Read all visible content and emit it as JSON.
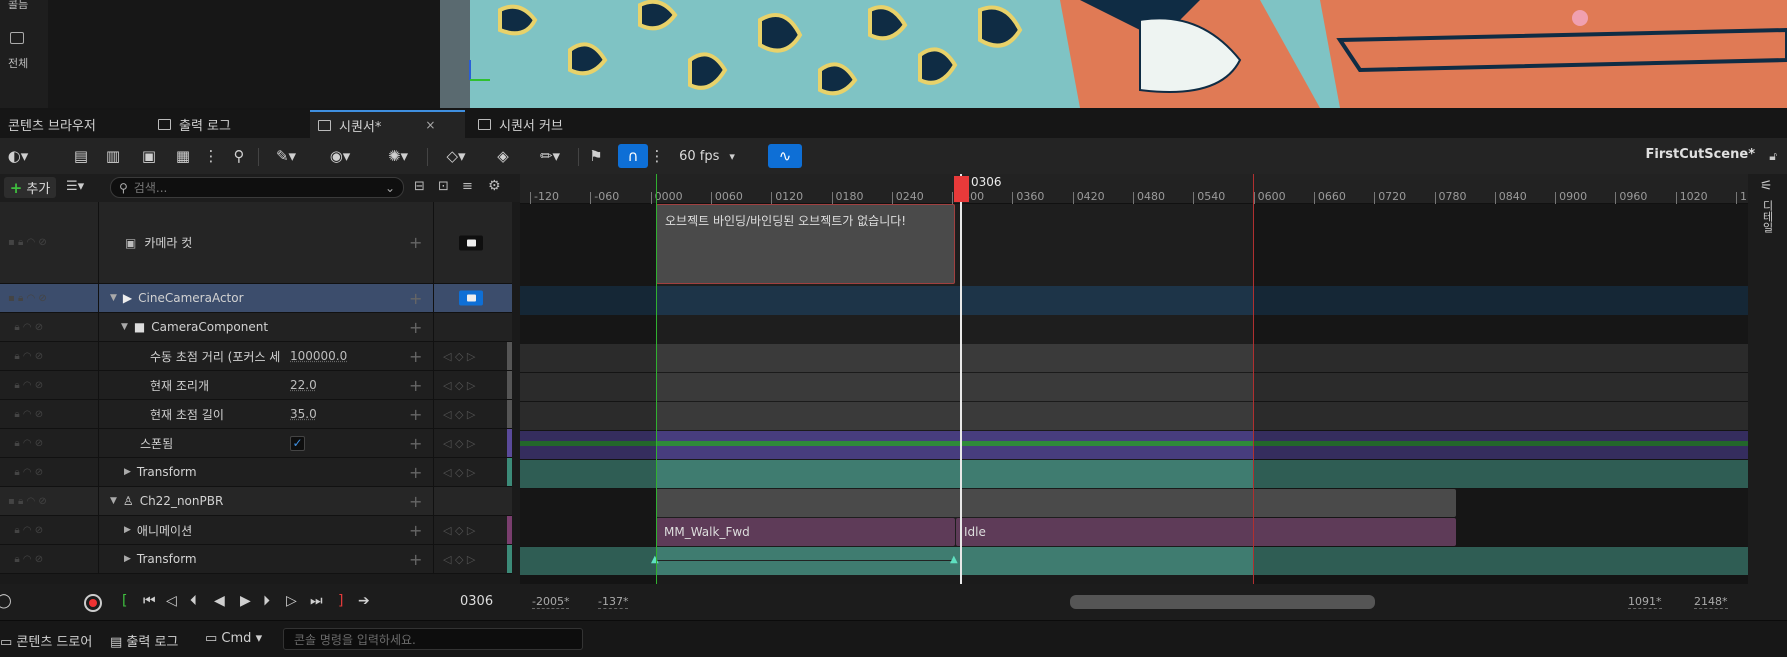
{
  "left_panel": {
    "item1_label": "콜듬",
    "item2_label": "전체"
  },
  "tabs": [
    {
      "label": "콘텐츠 브라우저"
    },
    {
      "label": "출력 로그"
    },
    {
      "label": "시퀀서*",
      "close": "×"
    },
    {
      "label": "시퀀서 커브"
    }
  ],
  "toolbar": {
    "fps": "60 fps",
    "scene_name": "FirstCutScene*"
  },
  "outliner": {
    "add_label": "추가",
    "search_placeholder": "검색...",
    "rows": [
      {
        "label": "카메라 컷"
      },
      {
        "label": "CineCameraActor"
      },
      {
        "label": "CameraComponent"
      },
      {
        "label": "수동 초점 거리 (포커스 세",
        "value": "100000.0"
      },
      {
        "label": "현재 조리개",
        "value": "22.0"
      },
      {
        "label": "현재 초점 길이",
        "value": "35.0"
      },
      {
        "label": "스폰됨",
        "checked": true
      },
      {
        "label": "Transform"
      },
      {
        "label": "Ch22_nonPBR"
      },
      {
        "label": "애니메이션"
      },
      {
        "label": "Transform"
      }
    ]
  },
  "timeline": {
    "ticks": [
      "-120",
      "-060",
      "0000",
      "0060",
      "0120",
      "0180",
      "0240",
      "0300",
      "0360",
      "0420",
      "0480",
      "0540",
      "0600",
      "0660",
      "0720",
      "0780",
      "0840",
      "0900",
      "0960",
      "1020",
      "1"
    ],
    "playhead_label": "0306",
    "camera_cut_message": "오브젝트 바인딩/바인딩된 오브젝트가 없습니다!",
    "anim_sections": [
      "MM_Walk_Fwd",
      "Idle"
    ]
  },
  "right_sidebar": {
    "details_label": "디테일"
  },
  "transport": {
    "current_frame": "0306"
  },
  "range": {
    "view_start": "-2005*",
    "play_start": "-137*",
    "play_end": "1091*",
    "view_end": "2148*"
  },
  "statusbar": {
    "drawer_label": "콘텐츠 드로어",
    "output_log_label": "출력 로그",
    "cmd_label": "Cmd",
    "cmd_placeholder": "콘솔 명령을 입력하세요."
  },
  "colors": {
    "accent": "#0e6fd6",
    "playhead": "#e83a3a",
    "start": "#30b030",
    "end": "#b03030"
  }
}
